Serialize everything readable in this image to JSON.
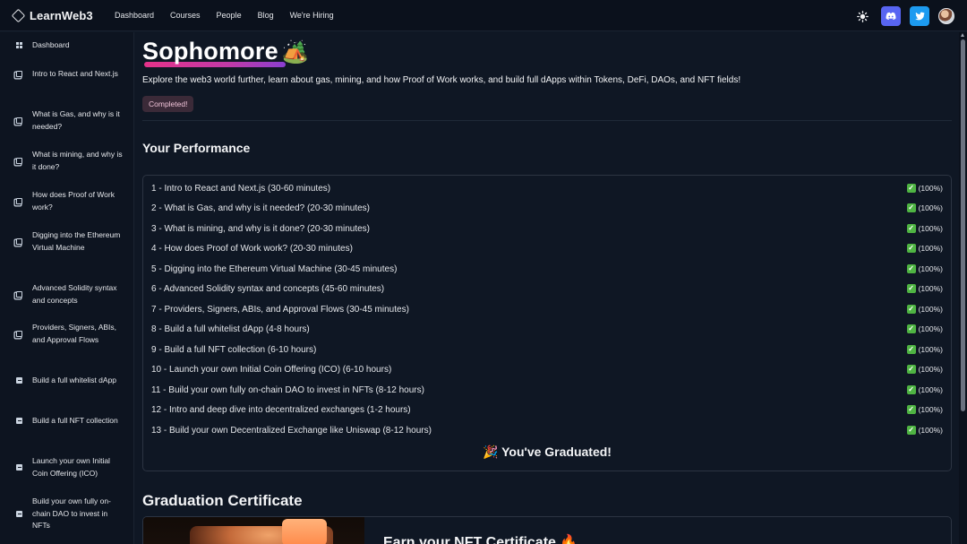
{
  "brand": {
    "name": "LearnWeb3"
  },
  "nav": {
    "links": [
      "Dashboard",
      "Courses",
      "People",
      "Blog",
      "We're Hiring"
    ]
  },
  "icons": {
    "logo": "diamond-logo-icon",
    "theme": "sun-icon",
    "discord": "discord-icon",
    "twitter": "twitter-icon",
    "avatar": "user-avatar"
  },
  "colors": {
    "discord": "#5865f2",
    "twitter": "#1d9bf0",
    "check": "#4fb443",
    "title_underline": "#e6328a"
  },
  "sidebar": {
    "items": [
      {
        "label": "Dashboard",
        "icon": "grid-icon"
      },
      {
        "label": "Intro to React and Next.js",
        "icon": "book-icon"
      },
      {
        "label": "What is Gas, and why is it needed?",
        "icon": "book-icon"
      },
      {
        "label": "What is mining, and why is it done?",
        "icon": "book-icon"
      },
      {
        "label": "How does Proof of Work work?",
        "icon": "book-icon"
      },
      {
        "label": "Digging into the Ethereum Virtual Machine",
        "icon": "book-icon"
      },
      {
        "label": "Advanced Solidity syntax and concepts",
        "icon": "book-icon"
      },
      {
        "label": "Providers, Signers, ABIs, and Approval Flows",
        "icon": "book-icon"
      },
      {
        "label": "Build a full whitelist dApp",
        "icon": "document-icon"
      },
      {
        "label": "Build a full NFT collection",
        "icon": "document-icon"
      },
      {
        "label": "Launch your own Initial Coin Offering (ICO)",
        "icon": "document-icon"
      },
      {
        "label": "Build your own fully on-chain DAO to invest in NFTs",
        "icon": "document-icon"
      }
    ]
  },
  "main": {
    "title": "Sophomore",
    "title_emoji": "🏕️",
    "description": "Explore the web3 world further, learn about gas, mining, and how Proof of Work works, and build full dApps within Tokens, DeFi, DAOs, and NFT fields!",
    "badge": "Completed!",
    "performance_heading": "Your Performance",
    "performance_rows": [
      {
        "label": "1 - Intro to React and Next.js (30-60 minutes)",
        "status": "(100%)"
      },
      {
        "label": "2 - What is Gas, and why is it needed? (20-30 minutes)",
        "status": "(100%)"
      },
      {
        "label": "3 - What is mining, and why is it done? (20-30 minutes)",
        "status": "(100%)"
      },
      {
        "label": "4 - How does Proof of Work work? (20-30 minutes)",
        "status": "(100%)"
      },
      {
        "label": "5 - Digging into the Ethereum Virtual Machine (30-45 minutes)",
        "status": "(100%)"
      },
      {
        "label": "6 - Advanced Solidity syntax and concepts (45-60 minutes)",
        "status": "(100%)"
      },
      {
        "label": "7 - Providers, Signers, ABIs, and Approval Flows (30-45 minutes)",
        "status": "(100%)"
      },
      {
        "label": "8 - Build a full whitelist dApp (4-8 hours)",
        "status": "(100%)"
      },
      {
        "label": "9 - Build a full NFT collection (6-10 hours)",
        "status": "(100%)"
      },
      {
        "label": "10 - Launch your own Initial Coin Offering (ICO) (6-10 hours)",
        "status": "(100%)"
      },
      {
        "label": "11 - Build your own fully on-chain DAO to invest in NFTs (8-12 hours)",
        "status": "(100%)"
      },
      {
        "label": "12 - Intro and deep dive into decentralized exchanges (1-2 hours)",
        "status": "(100%)"
      },
      {
        "label": "13 - Build your own Decentralized Exchange like Uniswap (8-12 hours)",
        "status": "(100%)"
      }
    ],
    "graduated": "🎉 You've Graduated!",
    "certificate_heading": "Graduation Certificate",
    "certificate_cta": "Earn your NFT Certificate 🔥"
  }
}
